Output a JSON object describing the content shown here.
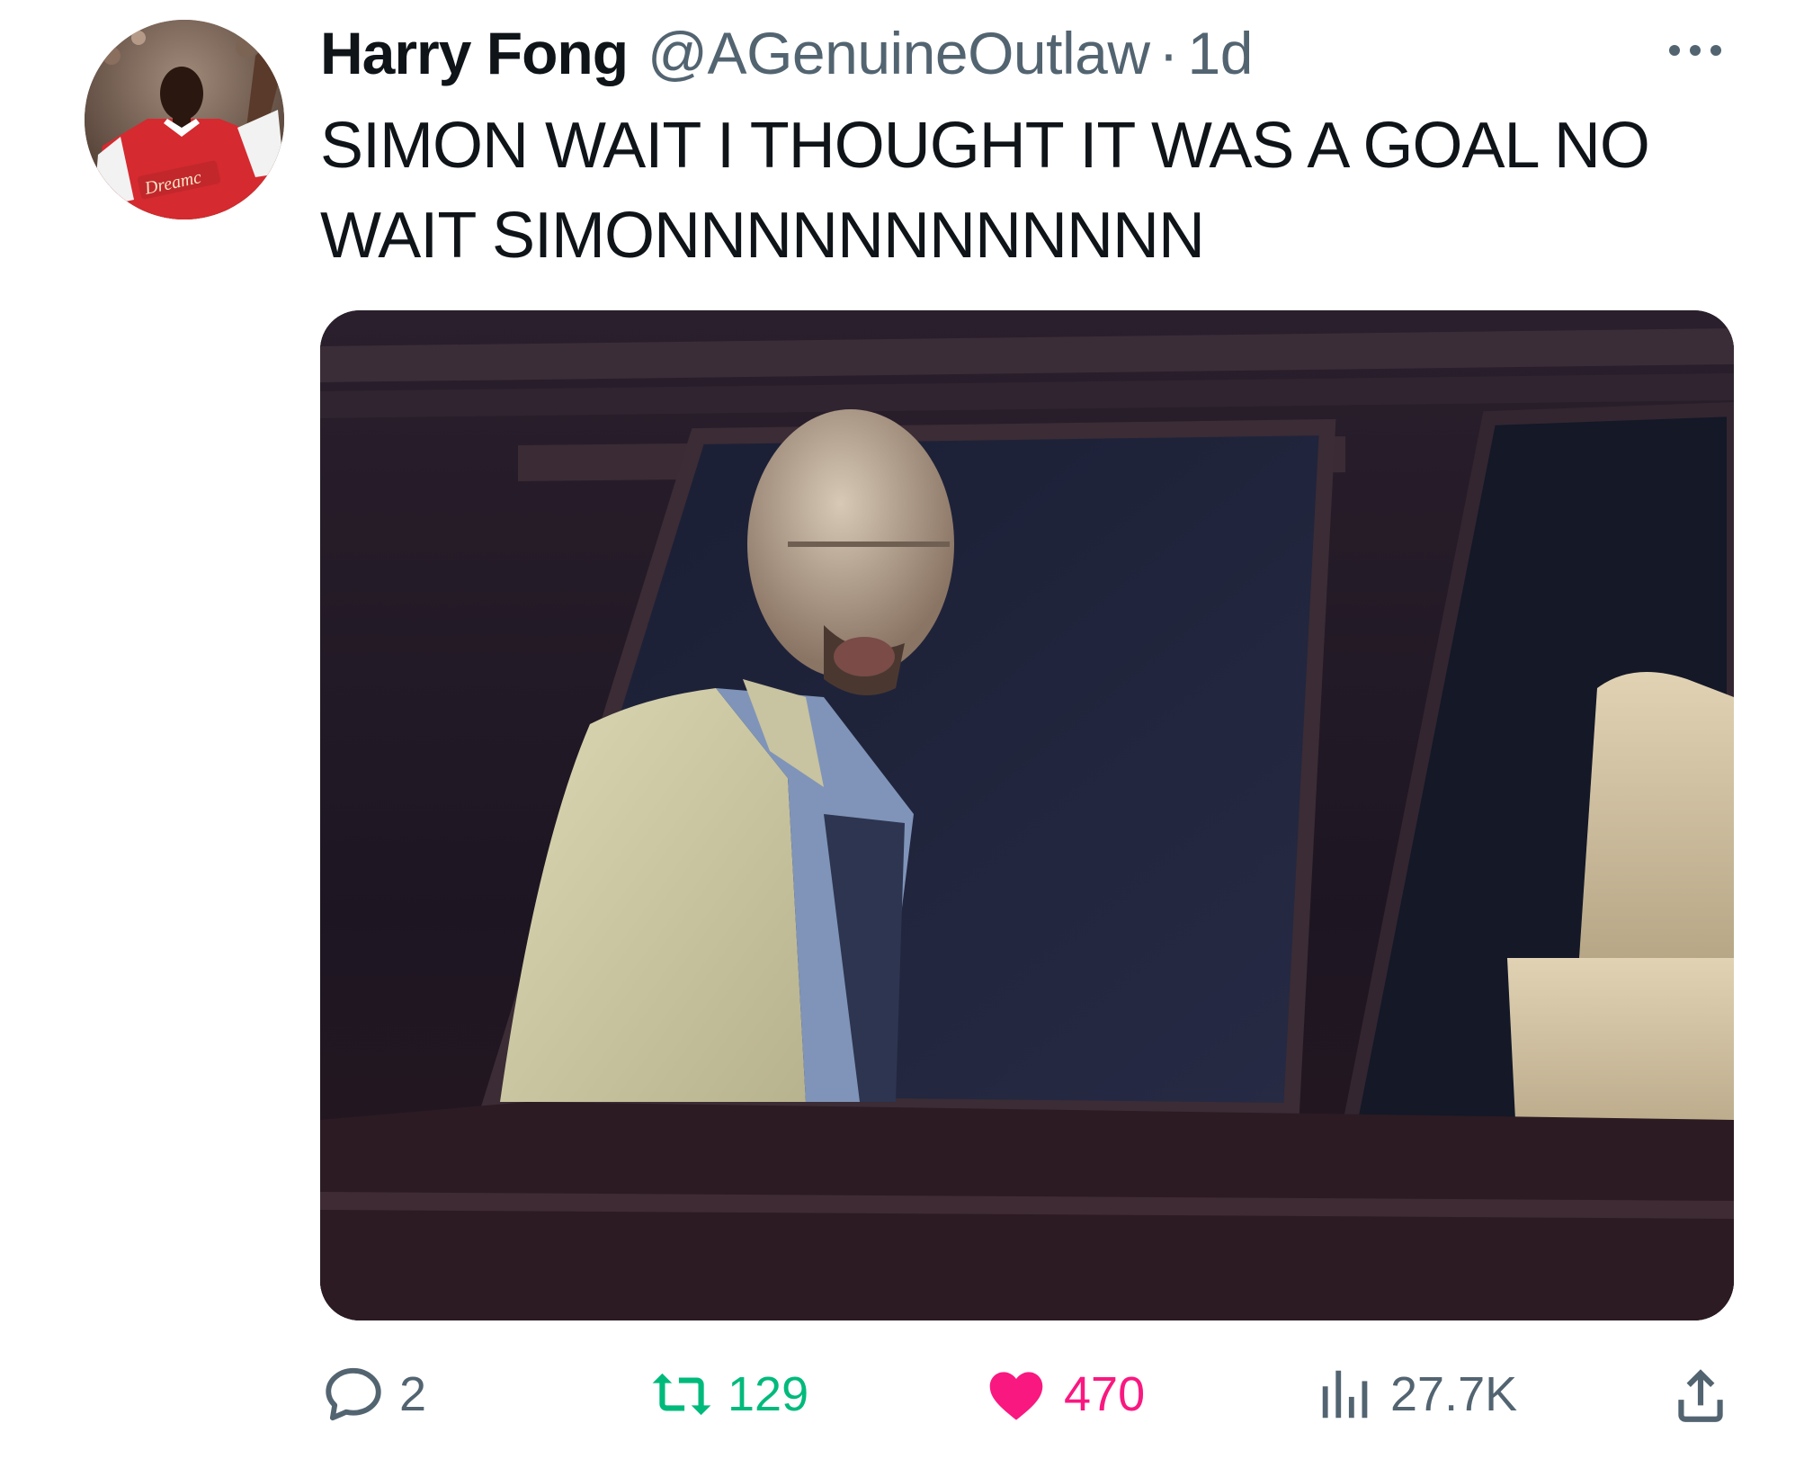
{
  "tweet": {
    "display_name": "Harry Fong",
    "handle": "@AGenuineOutlaw",
    "separator": "·",
    "time": "1d",
    "text_lines": [
      "SIMON WAIT I THOUGHT IT WAS A GOAL NO",
      "WAIT SIMONNNNNNNNNNNN"
    ],
    "avatar_shirt_text": "Dreamc"
  },
  "actions": {
    "replies": "2",
    "retweets": "129",
    "likes": "470",
    "views": "27.7K"
  },
  "colors": {
    "text": "#0f1419",
    "secondary": "#536471",
    "retweet": "#00ba7c",
    "like": "#f91880"
  },
  "icons": {
    "more": "more-icon",
    "reply": "reply-icon",
    "retweet": "retweet-icon",
    "like": "heart-icon",
    "views": "views-icon",
    "share": "share-icon"
  }
}
